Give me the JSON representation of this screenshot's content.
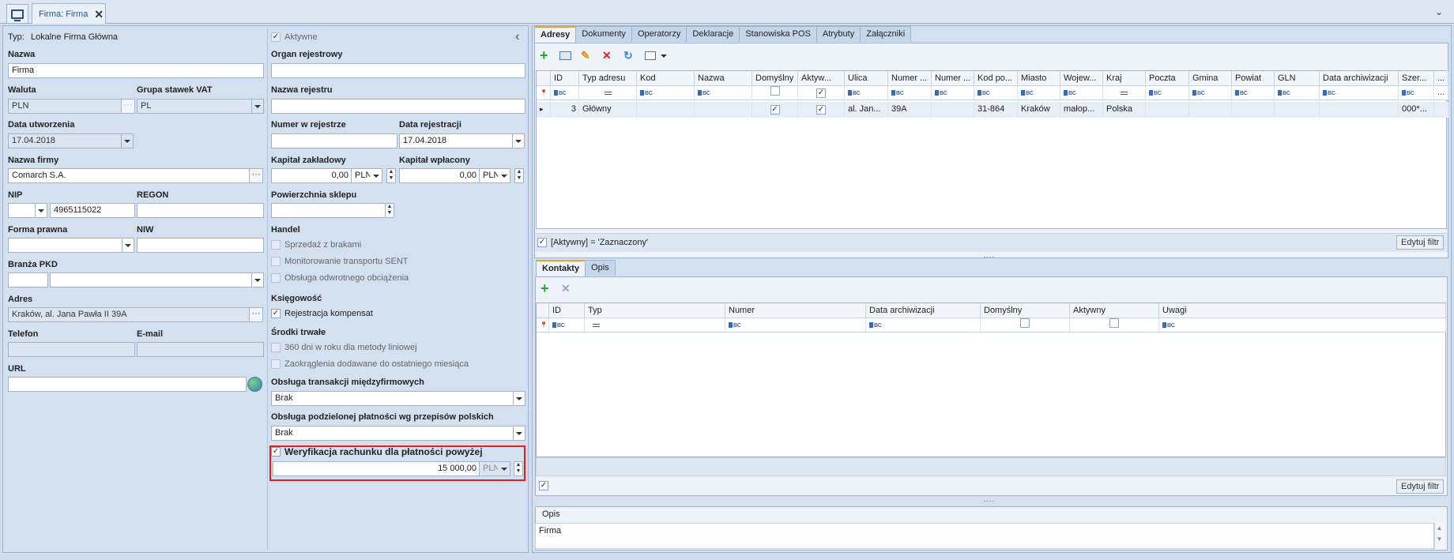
{
  "window": {
    "tab_title": "Firma: Firma"
  },
  "left": {
    "typ_label": "Typ:",
    "typ_value": "Lokalne Firma Główna",
    "aktywne_label": "Aktywne",
    "nazwa_label": "Nazwa",
    "nazwa_value": "Firma",
    "waluta_label": "Waluta",
    "waluta_value": "PLN",
    "grupa_vat_label": "Grupa stawek VAT",
    "grupa_vat_value": "PL",
    "data_utw_label": "Data utworzenia",
    "data_utw_value": "17.04.2018",
    "nazwa_firmy_label": "Nazwa firmy",
    "nazwa_firmy_value": "Comarch S.A.",
    "nip_label": "NIP",
    "nip_value": "4965115022",
    "regon_label": "REGON",
    "forma_prawna_label": "Forma prawna",
    "niw_label": "NIW",
    "branza_label": "Branża PKD",
    "adres_label": "Adres",
    "adres_value": "Kraków, al. Jana Pawła II 39A",
    "telefon_label": "Telefon",
    "email_label": "E-mail",
    "url_label": "URL",
    "collapse_glyph": "‹"
  },
  "middle": {
    "organ_label": "Organ rejestrowy",
    "nazwa_rej_label": "Nazwa rejestru",
    "numer_rej_label": "Numer w rejestrze",
    "data_rej_label": "Data rejestracji",
    "data_rej_value": "17.04.2018",
    "kap_zak_label": "Kapitał zakładowy",
    "kap_zak_value": "0,00",
    "kap_zak_cur": "PLN",
    "kap_wpl_label": "Kapitał wpłacony",
    "kap_wpl_value": "0,00",
    "kap_wpl_cur": "PLN",
    "powierzchnia_label": "Powierzchnia sklepu",
    "handel_label": "Handel",
    "handel_items": [
      "Sprzedaż z brakami",
      "Monitorowanie transportu SENT",
      "Obsługa odwrotnego obciążenia"
    ],
    "ksiegowosc_label": "Księgowość",
    "rejestracja_label": "Rejestracja kompensat",
    "srodki_label": "Środki trwałe",
    "srodki_items": [
      "360 dni w roku dla metody liniowej",
      "Zaokrąglenia dodawane do ostatniego miesiąca"
    ],
    "transakcje_label": "Obsługa transakcji międzyfirmowych",
    "transakcje_value": "Brak",
    "podzielona_label": "Obsługa podzielonej płatności wg przepisów polskich",
    "podzielona_value": "Brak",
    "weryfikacja_label": "Weryfikacja rachunku dla płatności powyżej",
    "weryfikacja_value": "15 000,00",
    "weryfikacja_cur": "PLN"
  },
  "right": {
    "tabs": [
      "Adresy",
      "Dokumenty",
      "Operatorzy",
      "Deklaracje",
      "Stanowiska POS",
      "Atrybuty",
      "Załączniki"
    ],
    "columns": [
      "ID",
      "Typ adresu",
      "Kod",
      "Nazwa",
      "Domyślny",
      "Aktyw...",
      "Ulica",
      "Numer ...",
      "Numer ...",
      "Kod po...",
      "Miasto",
      "Wojew...",
      "Kraj",
      "Poczta",
      "Gmina",
      "Powiat",
      "GLN",
      "Data archiwizacji",
      "Szer...",
      "..."
    ],
    "row": [
      "3",
      "Główny",
      "",
      "",
      "",
      "",
      "al. Jan...",
      "39A",
      "",
      "31-864",
      "Kraków",
      "małop...",
      "Polska",
      "",
      "",
      "",
      "",
      "",
      "000*...",
      ""
    ],
    "filter_text": "[Aktywny] = 'Zaznaczony'",
    "edit_filter": "Edytuj filtr",
    "contacts_tabs": [
      "Kontakty",
      "Opis"
    ],
    "contacts_columns": [
      "ID",
      "Typ",
      "Numer",
      "Data archiwizacji",
      "Domyślny",
      "Aktywny",
      "Uwagi"
    ],
    "edit_filter2": "Edytuj filtr",
    "opis_label": "Opis",
    "opis_value": "Firma",
    "abc": "BC"
  },
  "colors": {
    "accent": "#f0a030",
    "highlight": "#e02020",
    "panel": "#d3e0f0"
  }
}
